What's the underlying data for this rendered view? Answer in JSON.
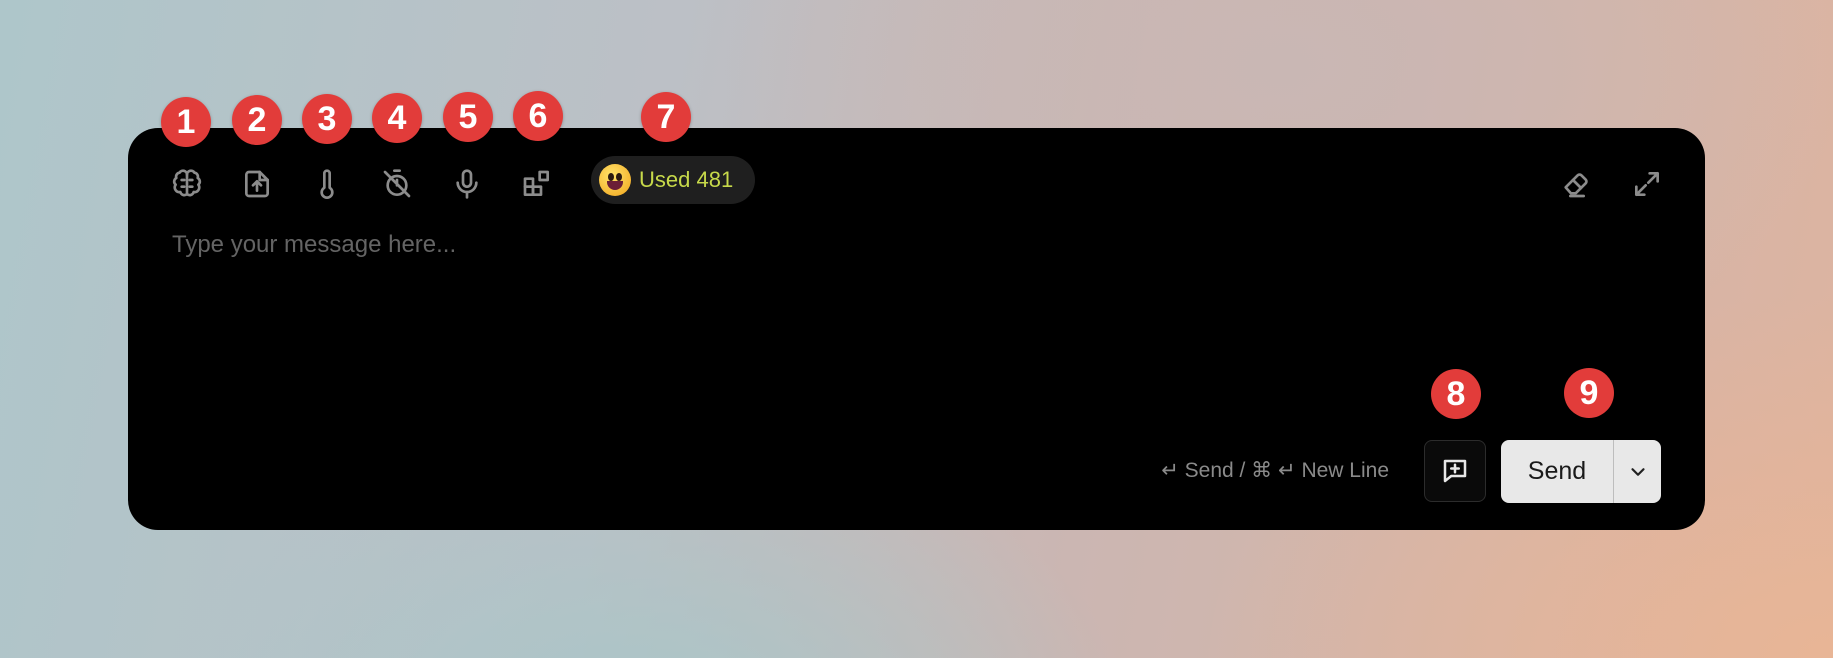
{
  "toolbar": {
    "icons": [
      {
        "name": "brain-icon"
      },
      {
        "name": "file-upload-icon"
      },
      {
        "name": "thermometer-icon"
      },
      {
        "name": "timer-off-icon"
      },
      {
        "name": "microphone-icon"
      },
      {
        "name": "plugins-icon"
      }
    ],
    "usage": {
      "emoji": "grinning-face-icon",
      "label": "Used 481",
      "color": "#c7d94a"
    },
    "right_icons": [
      {
        "name": "eraser-icon"
      },
      {
        "name": "expand-icon"
      }
    ]
  },
  "composer": {
    "placeholder": "Type your message here...",
    "value": ""
  },
  "footer": {
    "hint": "↵ Send / ⌘ ↵ New Line",
    "new_topic_icon": "message-plus-icon",
    "send_label": "Send",
    "send_menu_icon": "chevron-down-icon"
  },
  "markers": [
    "1",
    "2",
    "3",
    "4",
    "5",
    "6",
    "7",
    "8",
    "9"
  ],
  "colors": {
    "marker": "#e23c3a",
    "panel": "#000000",
    "send_button": "#e8e8e8"
  }
}
